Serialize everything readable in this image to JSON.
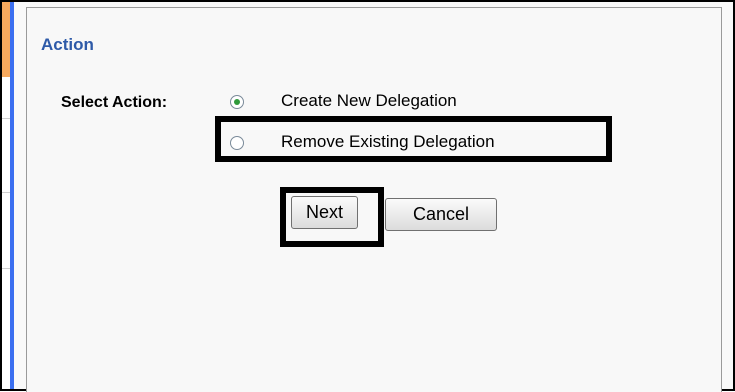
{
  "panel": {
    "title": "Action"
  },
  "form": {
    "select_label": "Select Action:",
    "options": [
      {
        "label": "Create New Delegation",
        "selected": true
      },
      {
        "label": "Remove Existing Delegation",
        "selected": false
      }
    ]
  },
  "buttons": {
    "next": "Next",
    "cancel": "Cancel"
  },
  "colors": {
    "title": "#2e5aa8",
    "accent_bar": "#3b6ff0",
    "radio_dot": "#2f9a3a",
    "gutter_orange": "#f7a95d"
  }
}
